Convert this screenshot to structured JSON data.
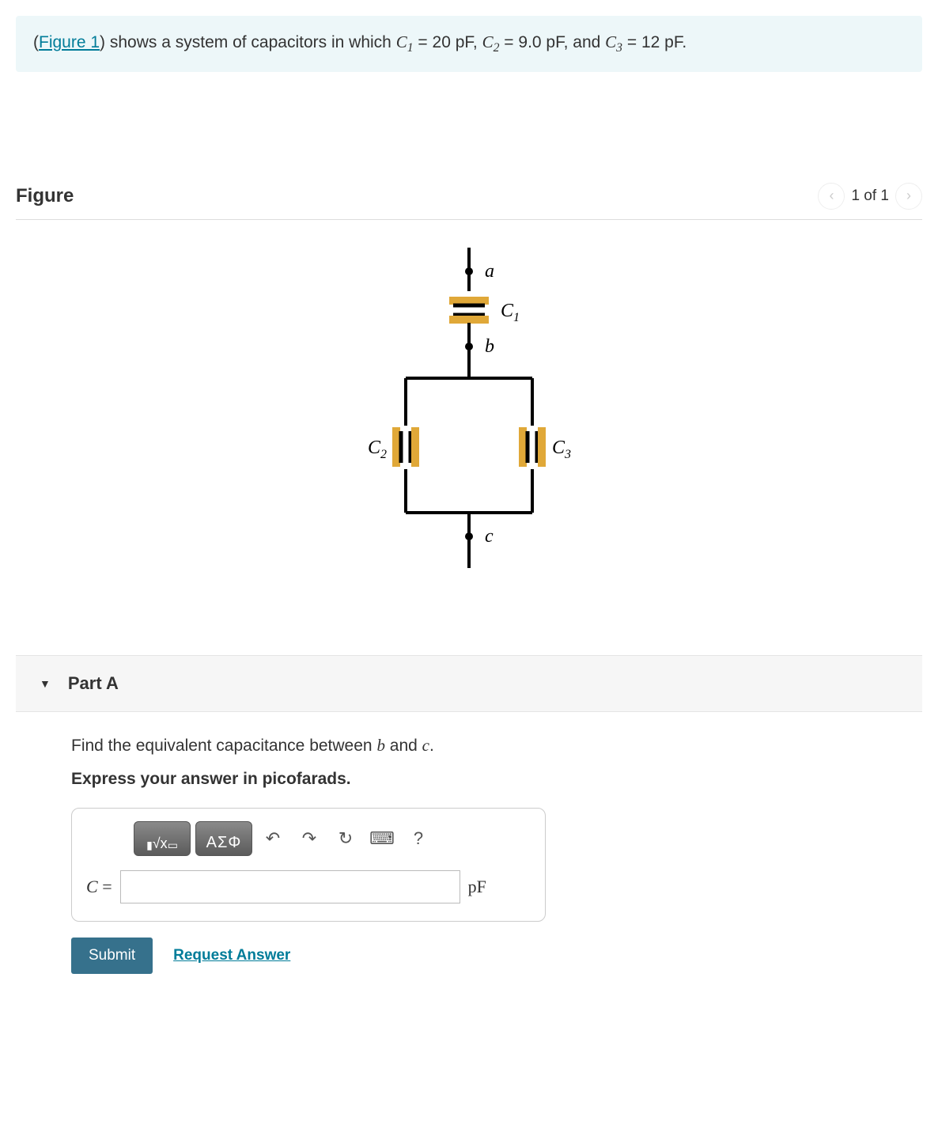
{
  "intro": {
    "figure_link": "Figure 1",
    "text_before": "(",
    "text_mid": ") shows a system of capacitors in which ",
    "c1_sym": "C",
    "c1_sub": "1",
    "c1_val": " = 20 pF, ",
    "c2_sym": "C",
    "c2_sub": "2",
    "c2_val": " = 9.0 pF, and ",
    "c3_sym": "C",
    "c3_sub": "3",
    "c3_val": " = 12 pF."
  },
  "figure": {
    "heading": "Figure",
    "pager_text": "1 of 1",
    "labels": {
      "a": "a",
      "b": "b",
      "c": "c",
      "C1": "C",
      "C1s": "1",
      "C2": "C",
      "C2s": "2",
      "C3": "C",
      "C3s": "3"
    }
  },
  "part": {
    "title": "Part A"
  },
  "question": {
    "prompt_pre": "Find the equivalent capacitance between ",
    "b": "b",
    "mid": " and ",
    "c": "c",
    "post": ".",
    "instruction": "Express your answer in picofarads."
  },
  "toolbar": {
    "templates": "√x",
    "greek": "ΑΣΦ",
    "help": "?"
  },
  "answer": {
    "label_sym": "C",
    "label_eq": " = ",
    "unit": "pF",
    "value": ""
  },
  "actions": {
    "submit": "Submit",
    "request": "Request Answer"
  },
  "chart_data": {
    "type": "circuit-diagram",
    "nodes": [
      "a",
      "b",
      "c"
    ],
    "components": [
      {
        "name": "C1",
        "value_pF": 20,
        "between": [
          "a",
          "b"
        ],
        "arrangement": "series (a to b)"
      },
      {
        "name": "C2",
        "value_pF": 9.0,
        "between": [
          "b",
          "c"
        ],
        "arrangement": "parallel branch left"
      },
      {
        "name": "C3",
        "value_pF": 12,
        "between": [
          "b",
          "c"
        ],
        "arrangement": "parallel branch right"
      }
    ],
    "question_terminals": [
      "b",
      "c"
    ]
  }
}
